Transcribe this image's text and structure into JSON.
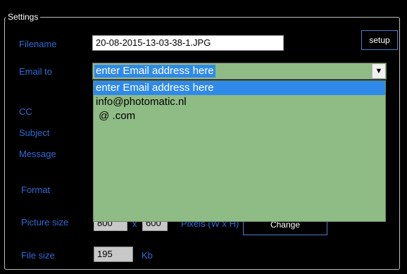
{
  "settings": {
    "group_title": "Settings",
    "filename": {
      "label": "Filename",
      "value": "20-08-2015-13-03-38-1.JPG"
    },
    "setup_label": "setup",
    "email_to": {
      "label": "Email to",
      "value": "enter Email address here",
      "options": [
        "enter Email address here",
        "info@photomatic.nl",
        " @ .com"
      ]
    },
    "cc_label": "CC",
    "subject_label": "Subject",
    "message_label": "Message",
    "format_label": "Format",
    "picture_size": {
      "label": "Picture size",
      "width": "800",
      "separator": "x",
      "height": "600",
      "units": "Pixels (W x H)",
      "change_label": "Change"
    },
    "file_size": {
      "label": "File size",
      "value": "195",
      "unit": "Kb"
    }
  },
  "colors": {
    "label_blue": "#2e6bd6",
    "dropdown_bg": "#8fbb85",
    "selection_blue": "#2f89e8"
  },
  "icons": {
    "dropdown_arrow": "chevron-down-icon"
  }
}
